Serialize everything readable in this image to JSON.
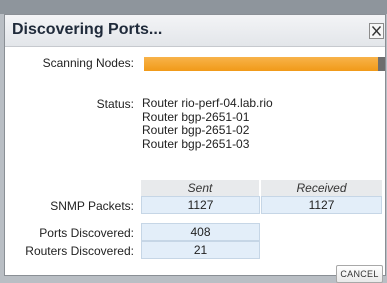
{
  "dialog": {
    "title": "Discovering Ports...",
    "close_icon": "close-x-icon"
  },
  "scan": {
    "label": "Scanning Nodes:",
    "progress_percent": 97
  },
  "status": {
    "label": "Status:",
    "lines": [
      "Router rio-perf-04.lab.rio",
      "Router bgp-2651-01",
      "Router bgp-2651-02",
      "Router bgp-2651-03"
    ]
  },
  "snmp": {
    "columns": [
      "Sent",
      "Received"
    ],
    "label": "SNMP Packets:",
    "sent": "1127",
    "received": "1127"
  },
  "discovered": {
    "ports_label": "Ports Discovered:",
    "ports_value": "408",
    "routers_label": "Routers Discovered:",
    "routers_value": "21"
  },
  "buttons": {
    "cancel_label": "CANCEL"
  },
  "colors": {
    "progress": "#f19a18",
    "cell_bg": "#e3eef9"
  }
}
